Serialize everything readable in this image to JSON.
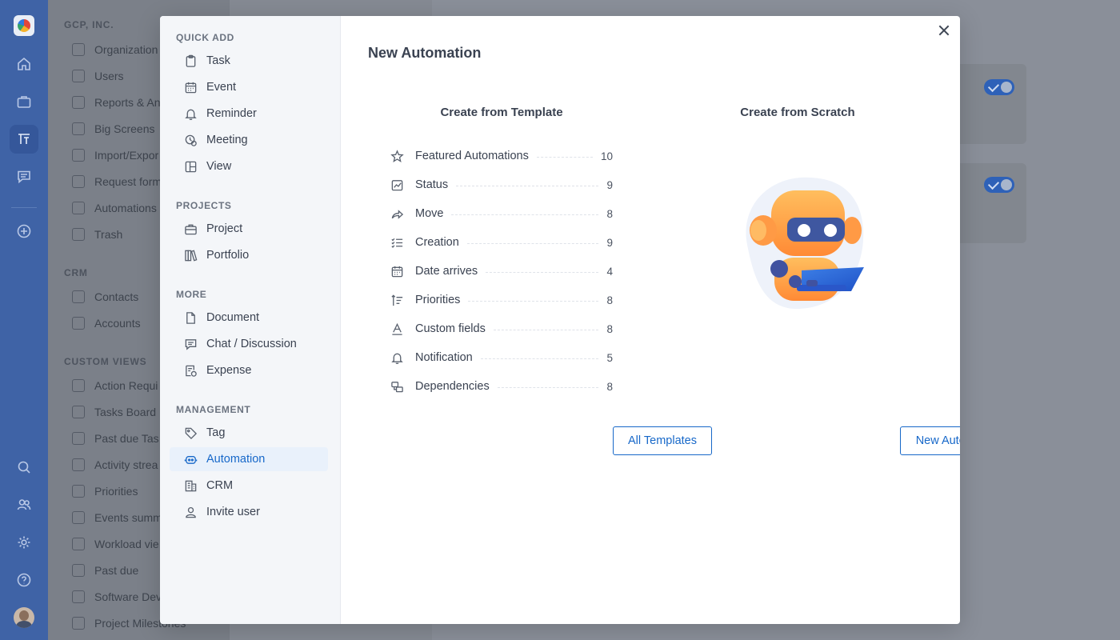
{
  "rail": {
    "icons": [
      "app-logo",
      "home-icon",
      "briefcase-icon",
      "workspace-icon",
      "chat-icon",
      "add-icon",
      "search-icon",
      "people-icon",
      "settings-icon",
      "help-icon",
      "user-avatar"
    ]
  },
  "sidebar": {
    "org_heading": "GCP, INC.",
    "org_items": [
      "Organization",
      "Users",
      "Reports & An",
      "Big Screens",
      "Import/Expor",
      "Request form",
      "Automations",
      "Trash"
    ],
    "crm_heading": "CRM",
    "crm_items": [
      "Contacts",
      "Accounts"
    ],
    "views_heading": "CUSTOM VIEWS",
    "views_items": [
      "Action Requi",
      "Tasks Board",
      "Past due Tas",
      "Activity strea",
      "Priorities",
      "Events summ",
      "Workload vie",
      "Past due",
      "Software Dev",
      "Project Milestones"
    ]
  },
  "modal": {
    "sidebar": {
      "quick_add_heading": "QUICK ADD",
      "quick_add": [
        {
          "label": "Task",
          "icon": "clipboard-icon"
        },
        {
          "label": "Event",
          "icon": "calendar-icon"
        },
        {
          "label": "Reminder",
          "icon": "bell-icon"
        },
        {
          "label": "Meeting",
          "icon": "meeting-icon"
        },
        {
          "label": "View",
          "icon": "view-icon"
        }
      ],
      "projects_heading": "PROJECTS",
      "projects": [
        {
          "label": "Project",
          "icon": "briefcase-icon"
        },
        {
          "label": "Portfolio",
          "icon": "books-icon"
        }
      ],
      "more_heading": "MORE",
      "more": [
        {
          "label": "Document",
          "icon": "document-icon"
        },
        {
          "label": "Chat / Discussion",
          "icon": "chat-icon"
        },
        {
          "label": "Expense",
          "icon": "expense-icon"
        }
      ],
      "management_heading": "MANAGEMENT",
      "management": [
        {
          "label": "Tag",
          "icon": "tag-icon"
        },
        {
          "label": "Automation",
          "icon": "robot-icon",
          "active": true
        },
        {
          "label": "CRM",
          "icon": "building-icon"
        },
        {
          "label": "Invite user",
          "icon": "user-icon"
        }
      ]
    },
    "title": "New Automation",
    "template_col_title": "Create from Template",
    "scratch_col_title": "Create from Scratch",
    "templates": [
      {
        "label": "Featured Automations",
        "count": "10",
        "icon": "star-icon"
      },
      {
        "label": "Status",
        "count": "9",
        "icon": "status-icon"
      },
      {
        "label": "Move",
        "count": "8",
        "icon": "move-arrow-icon"
      },
      {
        "label": "Creation",
        "count": "9",
        "icon": "checklist-icon"
      },
      {
        "label": "Date arrives",
        "count": "4",
        "icon": "calendar-icon"
      },
      {
        "label": "Priorities",
        "count": "8",
        "icon": "priority-icon"
      },
      {
        "label": "Custom fields",
        "count": "8",
        "icon": "text-field-icon"
      },
      {
        "label": "Notification",
        "count": "5",
        "icon": "bell-icon"
      },
      {
        "label": "Dependencies",
        "count": "8",
        "icon": "dependencies-icon"
      }
    ],
    "all_templates_label": "All Templates",
    "new_automation_label": "New Automation"
  },
  "colors": {
    "accent": "#1768c9",
    "rail": "#3f63a6",
    "active_bg": "#e9f1fb"
  }
}
